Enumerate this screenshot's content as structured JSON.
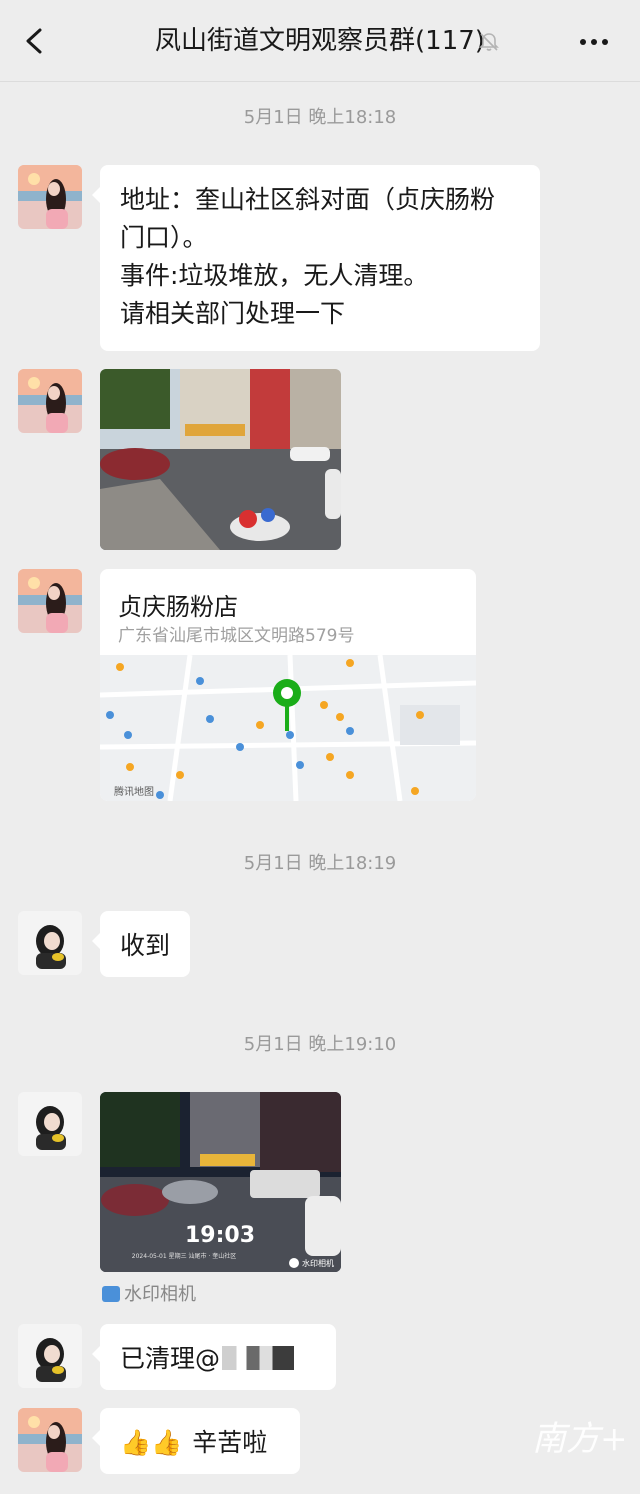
{
  "header": {
    "title": "凤山街道文明观察员群(117)",
    "back_icon": "chevron-left-icon",
    "mute_icon": "bell-off-icon",
    "more_icon": "ellipsis-icon"
  },
  "timestamps": [
    "5月1日 晚上18:18",
    "5月1日 晚上18:19",
    "5月1日 晚上19:10"
  ],
  "messages": {
    "m1": {
      "lines": [
        "地址：奎山社区斜对面（贞庆肠粉",
        "门口）。",
        "事件:垃圾堆放，无人清理。",
        "请相关部门处理一下"
      ]
    },
    "m4": {
      "text": "收到"
    },
    "m6": {
      "text": "已清理@"
    },
    "m7": {
      "text": "辛苦啦",
      "emoji": "👍👍"
    }
  },
  "location": {
    "name": "贞庆肠粉店",
    "address": "广东省汕尾市城区文明路579号",
    "map_watermark": "腾讯地图"
  },
  "photo2": {
    "clock": "19:03",
    "caption": "2024-05-01 星期三  汕尾市 · 奎山社区",
    "stamp": "水印相机"
  },
  "watermark_source": "水印相机",
  "logo_text": "南方+",
  "colors": {
    "background": "#ededed",
    "bubble": "#ffffff",
    "map_pin": "#1aad19",
    "timestamp": "#9a9a9a"
  }
}
